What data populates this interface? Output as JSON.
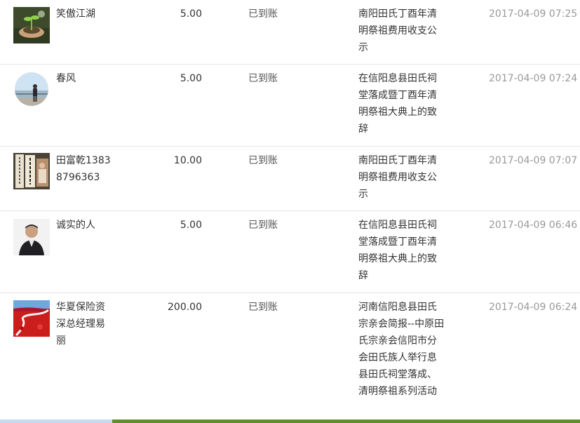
{
  "records": [
    {
      "name": "笑傲江湖",
      "amount": "5.00",
      "status": "已到账",
      "article": "南阳田氏丁酉年清明祭祖费用收支公示",
      "time": "2017-04-09 07:25",
      "avatar_icon": "seedling-in-hands-avatar"
    },
    {
      "name": "春风",
      "amount": "5.00",
      "status": "已到账",
      "article": "在信阳息县田氏祠堂落成暨丁酉年清明祭祖大典上的致辞",
      "time": "2017-04-09 07:24",
      "avatar_icon": "person-by-river-avatar"
    },
    {
      "name": "田富乾13838796363",
      "amount": "10.00",
      "status": "已到账",
      "article": "南阳田氏丁酉年清明祭祖费用收支公示",
      "time": "2017-04-09 07:07",
      "avatar_icon": "calligraphy-banner-avatar"
    },
    {
      "name": "诚实的人",
      "amount": "5.00",
      "status": "已到账",
      "article": "在信阳息县田氏祠堂落成暨丁酉年清明祭祖大典上的致辞",
      "time": "2017-04-09 06:46",
      "avatar_icon": "man-portrait-avatar"
    },
    {
      "name": "华夏保险资深总经理易丽",
      "amount": "200.00",
      "status": "已到账",
      "article": "河南信阳息县田氏宗亲会简报--中原田氏宗亲会信阳市分会田氏族人举行息县田氏祠堂落成、清明祭祖系列活动",
      "time": "2017-04-09 06:24",
      "avatar_icon": "red-landscape-avatar"
    }
  ],
  "colors": {
    "divider": "#e6e6e6",
    "time_text": "#999999",
    "bottom_bar": "#5f8f2a"
  }
}
